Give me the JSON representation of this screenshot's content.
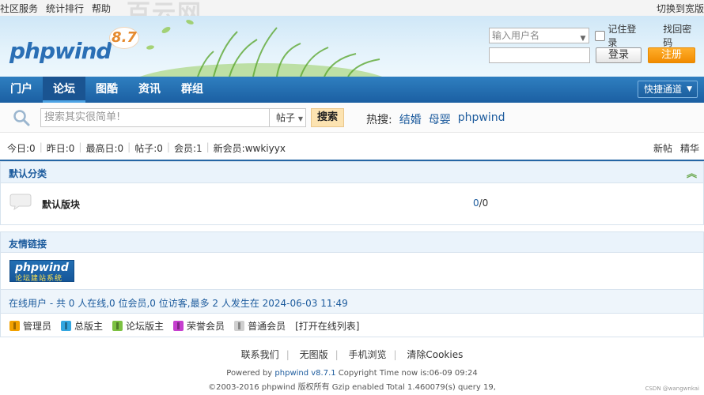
{
  "topbar": {
    "links": [
      "社区服务",
      "统计排行",
      "帮助"
    ],
    "ghost_text": "百云网",
    "wide_label": "切换到宽版"
  },
  "header": {
    "logo_text": "phpwind",
    "logo_version": "8.7",
    "username_placeholder": "输入用户名",
    "remember_label": "记住登录",
    "forgot_label": "找回密码",
    "login_label": "登录",
    "register_label": "注册"
  },
  "nav": {
    "items": [
      "门户",
      "论坛",
      "图酷",
      "资讯",
      "群组"
    ],
    "active_index": 1,
    "quick_label": "快捷通道"
  },
  "search": {
    "placeholder": "搜索其实很简单!",
    "scope": "帖子",
    "button": "搜索",
    "hot_label": "热搜:",
    "hot_keywords": [
      "结婚",
      "母婴",
      "phpwind"
    ]
  },
  "stats": {
    "items": [
      "今日:0",
      "昨日:0",
      "最高日:0",
      "帖子:0",
      "会员:1",
      "新会员:wwkiyyx"
    ],
    "right_links": [
      "新帖",
      "精华"
    ]
  },
  "category": {
    "title": "默认分类",
    "forum_name": "默认版块",
    "count_topics": "0",
    "count_posts": "/0"
  },
  "links": {
    "title": "友情链接",
    "banner_main": "phpwind",
    "banner_sub": "论坛建站系统"
  },
  "online": {
    "text": "在线用户 - 共 0 人在线,0 位会员,0 位访客,最多 2 人发生在 2024-06-03 11:49"
  },
  "legend": {
    "items": [
      {
        "label": "管理员",
        "color": "#f2a100"
      },
      {
        "label": "总版主",
        "color": "#33a6e0"
      },
      {
        "label": "论坛版主",
        "color": "#7cc142"
      },
      {
        "label": "荣誉会员",
        "color": "#c63fcf"
      },
      {
        "label": "普通会员",
        "color": "#cfcfcf"
      }
    ],
    "open_list": "[打开在线列表]"
  },
  "footer": {
    "links": [
      "联系我们",
      "无图版",
      "手机浏览",
      "清除Cookies"
    ],
    "powered_prefix": "Powered by ",
    "powered_link": "phpwind v8.7.1",
    "powered_suffix": " Copyright Time now is:06-09 09:24",
    "copyright": "©2003-2016 phpwind 版权所有 Gzip enabled Total 1.460079(s) query 19,"
  },
  "watermark": "CSDN @wangwnkai",
  "colors": {
    "nav": "#1b5fa2",
    "accent": "#1c5b9d",
    "register": "#f18b00"
  }
}
